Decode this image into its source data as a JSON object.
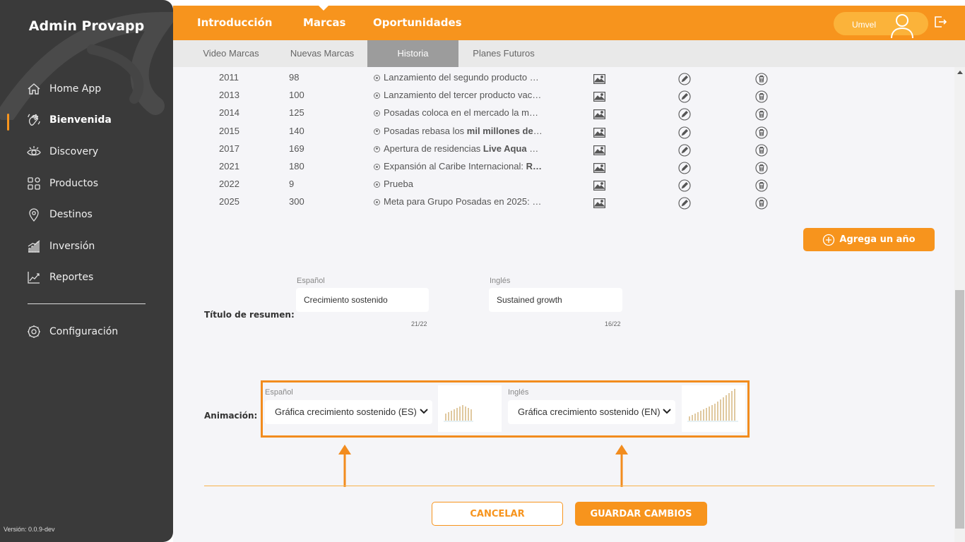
{
  "sidebar": {
    "brand": "Admin Provapp",
    "items": [
      {
        "label": "Home App",
        "icon": "home-icon"
      },
      {
        "label": "Bienvenida",
        "icon": "waving-hand-icon"
      },
      {
        "label": "Discovery",
        "icon": "eye-icon"
      },
      {
        "label": "Productos",
        "icon": "grid-icon"
      },
      {
        "label": "Destinos",
        "icon": "map-pin-icon"
      },
      {
        "label": "Inversión",
        "icon": "bar-chart-icon"
      },
      {
        "label": "Reportes",
        "icon": "line-chart-icon"
      },
      {
        "label": "Configuración",
        "icon": "gear-icon"
      }
    ],
    "active_index": 1,
    "version": "Versión: 0.0.9-dev"
  },
  "topbar": {
    "tabs": [
      "Introducción",
      "Marcas",
      "Oportunidades"
    ],
    "active": "Marcas",
    "user": "Umvel",
    "accent": "#f7941d"
  },
  "subtabs": {
    "items": [
      "Video Marcas",
      "Nuevas Marcas",
      "Historia",
      "Planes Futuros"
    ],
    "active": "Historia"
  },
  "history": {
    "rows": [
      {
        "year": "2011",
        "num": "98",
        "desc_plain": "Lanzamiento del segundo producto v…",
        "desc_bold": ""
      },
      {
        "year": "2013",
        "num": "100",
        "desc_plain": "Lanzamiento del tercer producto vac…",
        "desc_bold": ""
      },
      {
        "year": "2014",
        "num": "125",
        "desc_plain": "Posadas coloca en el mercado la ma…",
        "desc_bold": ""
      },
      {
        "year": "2015",
        "num": "140",
        "desc_plain": "Posadas rebasa los ",
        "desc_bold": "mil millones de …"
      },
      {
        "year": "2017",
        "num": "169",
        "desc_plain": "Apertura de residencias ",
        "desc_bold": "Live Aqua R…"
      },
      {
        "year": "2021",
        "num": "180",
        "desc_plain": "Expansión al Caribe Internacional: ",
        "desc_bold": "R…"
      },
      {
        "year": "2022",
        "num": "9",
        "desc_plain": "Prueba",
        "desc_bold": ""
      },
      {
        "year": "2025",
        "num": "300",
        "desc_plain": "Meta para Grupo Posadas en 2025: t…",
        "desc_bold": ""
      }
    ],
    "add_year_label": "Agrega un año"
  },
  "summary": {
    "label": "Título de resumen:",
    "es_label": "Español",
    "en_label": "Inglés",
    "es_value": "Crecimiento sostenido",
    "en_value": "Sustained growth",
    "es_counter": "21/22",
    "en_counter": "16/22"
  },
  "animation": {
    "label": "Animación:",
    "es_label": "Español",
    "en_label": "Inglés",
    "es_value": "Gráfica crecimiento sostenido (ES)",
    "en_value": "Gráfica crecimiento sostenido (EN)",
    "highlight_color": "#f28c1e"
  },
  "actions": {
    "cancel": "CANCELAR",
    "save": "GUARDAR CAMBIOS"
  }
}
